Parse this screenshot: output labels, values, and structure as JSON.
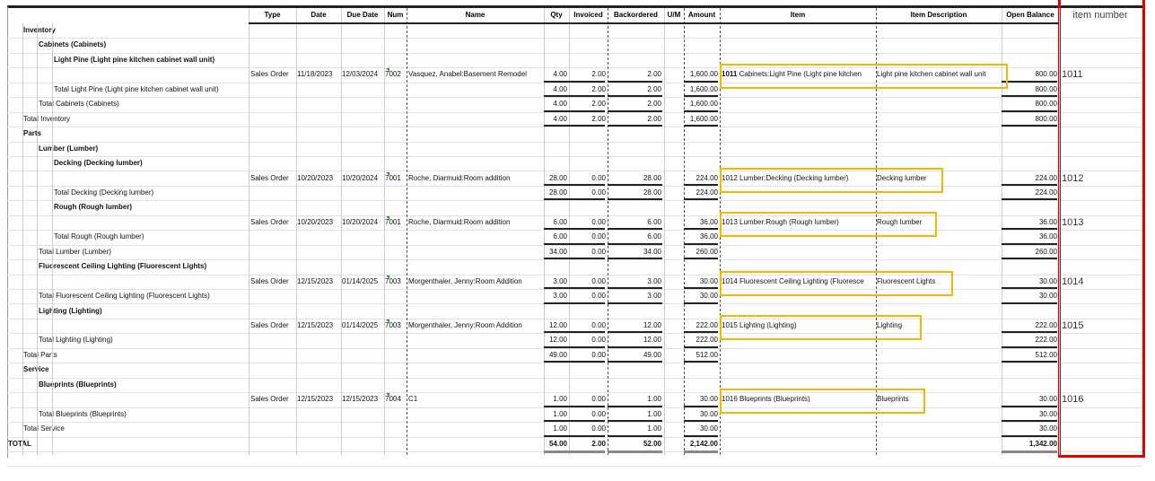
{
  "headers": {
    "type": "Type",
    "date": "Date",
    "due": "Due Date",
    "num": "Num",
    "name": "Name",
    "qty": "Qty",
    "inv": "Invoiced",
    "back": "Backordered",
    "um": "U/M",
    "amount": "Amount",
    "item": "Item",
    "desc": "Item Description",
    "open": "Open Balance",
    "itemnum": "item number"
  },
  "accent": {
    "highlight_box": "#f5b800",
    "item_number_column_box": "#e00000"
  },
  "rows": [
    {
      "label": "Inventory",
      "level": 0,
      "bold": true
    },
    {
      "label": "Cabinets (Cabinets)",
      "level": 1,
      "bold": true
    },
    {
      "label": "Light Pine (Light pine kitchen cabinet wall unit)",
      "level": 2,
      "bold": true
    },
    {
      "type": "Sales Order",
      "date": "11/18/2023",
      "due": "12/03/2024",
      "num": "7002",
      "name": "Vasquez, Anabel:Basement Remodel",
      "qty": "4.00",
      "inv": "2.00",
      "back": "2.00",
      "amount": "1,600.00",
      "item_code": "1011",
      "item": "Cabinets:Light Pine (Light pine kitchen",
      "desc": "Light pine kitchen cabinet wall unit",
      "open": "800.00",
      "itemnum": "1011"
    },
    {
      "label": "Total Light Pine (Light pine kitchen cabinet wall unit)",
      "level": 2,
      "qty": "4.00",
      "inv": "2.00",
      "back": "2.00",
      "amount": "1,600.00",
      "open": "800.00"
    },
    {
      "label": "Total Cabinets (Cabinets)",
      "level": 1,
      "qty": "4.00",
      "inv": "2.00",
      "back": "2.00",
      "amount": "1,600.00",
      "open": "800.00"
    },
    {
      "label": "Total Inventory",
      "level": 0,
      "qty": "4.00",
      "inv": "2.00",
      "back": "2.00",
      "amount": "1,600.00",
      "open": "800.00"
    },
    {
      "label": "Parts",
      "level": 0,
      "bold": true
    },
    {
      "label": "Lumber (Lumber)",
      "level": 1,
      "bold": true
    },
    {
      "label": "Decking (Decking lumber)",
      "level": 2,
      "bold": true
    },
    {
      "type": "Sales Order",
      "date": "10/20/2023",
      "due": "10/20/2024",
      "num": "7001",
      "name": "Roche, Diarmuid:Room addition",
      "qty": "28.00",
      "inv": "0.00",
      "back": "28.00",
      "amount": "224.00",
      "item": "1012 Lumber:Decking (Decking lumber)",
      "desc": "Decking lumber",
      "open": "224.00",
      "itemnum": "1012"
    },
    {
      "label": "Total Decking (Decking lumber)",
      "level": 2,
      "qty": "28.00",
      "inv": "0.00",
      "back": "28.00",
      "amount": "224.00",
      "open": "224.00"
    },
    {
      "label": "Rough (Rough lumber)",
      "level": 2,
      "bold": true
    },
    {
      "type": "Sales Order",
      "date": "10/20/2023",
      "due": "10/20/2024",
      "num": "7001",
      "name": "Roche, Diarmuid:Room addition",
      "qty": "6.00",
      "inv": "0.00",
      "back": "6.00",
      "amount": "36.00",
      "item": "1013 Lumber:Rough (Rough lumber)",
      "desc": "Rough lumber",
      "open": "36.00",
      "itemnum": "1013"
    },
    {
      "label": "Total Rough (Rough lumber)",
      "level": 2,
      "qty": "6.00",
      "inv": "0.00",
      "back": "6.00",
      "amount": "36.00",
      "open": "36.00"
    },
    {
      "label": "Total Lumber (Lumber)",
      "level": 1,
      "qty": "34.00",
      "inv": "0.00",
      "back": "34.00",
      "amount": "260.00",
      "open": "260.00"
    },
    {
      "label": "Fluorescent Ceiling Lighting (Fluorescent Lights)",
      "level": 1,
      "bold": true
    },
    {
      "type": "Sales Order",
      "date": "12/15/2023",
      "due": "01/14/2025",
      "num": "7003",
      "name": "Morgenthaler, Jenny:Room Addition",
      "qty": "3.00",
      "inv": "0.00",
      "back": "3.00",
      "amount": "30.00",
      "item": "1014 Fluorescent Ceiling Lighting (Fluoresce",
      "desc": "Fluorescent Lights",
      "open": "30.00",
      "itemnum": "1014"
    },
    {
      "label": "Total Fluorescent Ceiling Lighting (Fluorescent Lights)",
      "level": 1,
      "qty": "3.00",
      "inv": "0.00",
      "back": "3.00",
      "amount": "30.00",
      "open": "30.00"
    },
    {
      "label": "Lighting (Lighting)",
      "level": 1,
      "bold": true
    },
    {
      "type": "Sales Order",
      "date": "12/15/2023",
      "due": "01/14/2025",
      "num": "7003",
      "name": "Morgenthaler, Jenny:Room Addition",
      "qty": "12.00",
      "inv": "0.00",
      "back": "12.00",
      "amount": "222.00",
      "item": "1015 Lighting (Lighting)",
      "desc": "Lighting",
      "open": "222.00",
      "itemnum": "1015"
    },
    {
      "label": "Total Lighting (Lighting)",
      "level": 1,
      "qty": "12.00",
      "inv": "0.00",
      "back": "12.00",
      "amount": "222.00",
      "open": "222.00"
    },
    {
      "label": "Total Parts",
      "level": 0,
      "qty": "49.00",
      "inv": "0.00",
      "back": "49.00",
      "amount": "512.00",
      "open": "512.00"
    },
    {
      "label": "Service",
      "level": 0,
      "bold": true
    },
    {
      "label": "Blueprints (Blueprints)",
      "level": 1,
      "bold": true
    },
    {
      "type": "Sales Order",
      "date": "12/15/2023",
      "due": "12/15/2023",
      "num": "7004",
      "name": "C1",
      "qty": "1.00",
      "inv": "0.00",
      "back": "1.00",
      "amount": "30.00",
      "item": "1016 Blueprints (Blueprints)",
      "desc": "Blueprints",
      "open": "30.00",
      "itemnum": "1016"
    },
    {
      "label": "Total Blueprints (Blueprints)",
      "level": 1,
      "qty": "1.00",
      "inv": "0.00",
      "back": "1.00",
      "amount": "30.00",
      "open": "30.00"
    },
    {
      "label": "Total Service",
      "level": 0,
      "qty": "1.00",
      "inv": "0.00",
      "back": "1.00",
      "amount": "30.00",
      "open": "30.00"
    },
    {
      "label": "TOTAL",
      "level": -1,
      "bold": true,
      "qty": "54.00",
      "inv": "2.00",
      "back": "52.00",
      "amount": "2,142.00",
      "open": "1,342.00"
    },
    {}
  ]
}
